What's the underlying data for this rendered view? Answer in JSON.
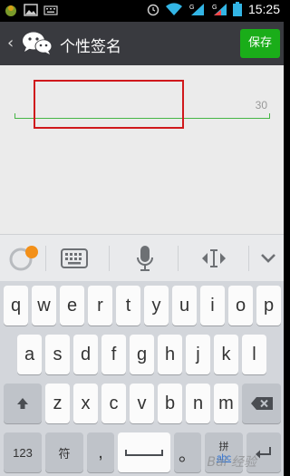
{
  "status_bar": {
    "time": "15:25",
    "icons": [
      "notification-app-icon",
      "gallery-icon",
      "keyboard-notif-icon",
      "alarm-icon",
      "wifi-icon",
      "signal-g-icon",
      "signal-g2-icon",
      "battery-icon"
    ],
    "signal_labels": [
      "G",
      "G"
    ]
  },
  "header": {
    "back_glyph": "‹",
    "title": "个性签名",
    "save_label": "保存"
  },
  "signature": {
    "value": "",
    "counter": "30"
  },
  "keyboard": {
    "row1": [
      "q",
      "w",
      "e",
      "r",
      "t",
      "y",
      "u",
      "i",
      "o",
      "p"
    ],
    "row2": [
      "a",
      "s",
      "d",
      "f",
      "g",
      "h",
      "j",
      "k",
      "l"
    ],
    "row3": [
      "z",
      "x",
      "c",
      "v",
      "b",
      "n",
      "m"
    ],
    "num_label": "123",
    "symbol_label": "符",
    "comma": ",",
    "period": "。",
    "lang_top": "拼",
    "lang_bottom": "abc"
  },
  "watermark": "Bai 经验",
  "colors": {
    "action_bar": "#393a3f",
    "save_green": "#1aad19",
    "underline_green": "#46b545",
    "highlight_red": "#d0191c",
    "content_bg": "#ebebeb"
  }
}
